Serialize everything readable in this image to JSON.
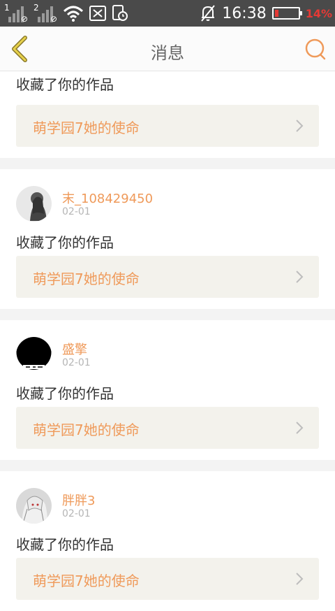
{
  "statusbar": {
    "sim1": "1",
    "sim2": "2",
    "time": "16:38",
    "battery": "14%"
  },
  "header": {
    "title": "消息",
    "back_icon": "chevron-left-icon",
    "search_icon": "search-icon"
  },
  "feed": {
    "first_action": "收藏了你的作品",
    "first_work": "萌学园7她的使命",
    "items": [
      {
        "username": "末_108429450",
        "date": "02-01",
        "action": "收藏了你的作品",
        "work": "萌学园7她的使命"
      },
      {
        "username": "盛擎",
        "date": "02-01",
        "action": "收藏了你的作品",
        "work": "萌学园7她的使命"
      },
      {
        "username": "胖胖3",
        "date": "02-01",
        "action": "收藏了你的作品",
        "work": "萌学园7她的使命"
      }
    ]
  },
  "colors": {
    "accent": "#ef9a5a",
    "statusbar": "#4a4a4a",
    "work_bg": "#f3f2ec"
  }
}
